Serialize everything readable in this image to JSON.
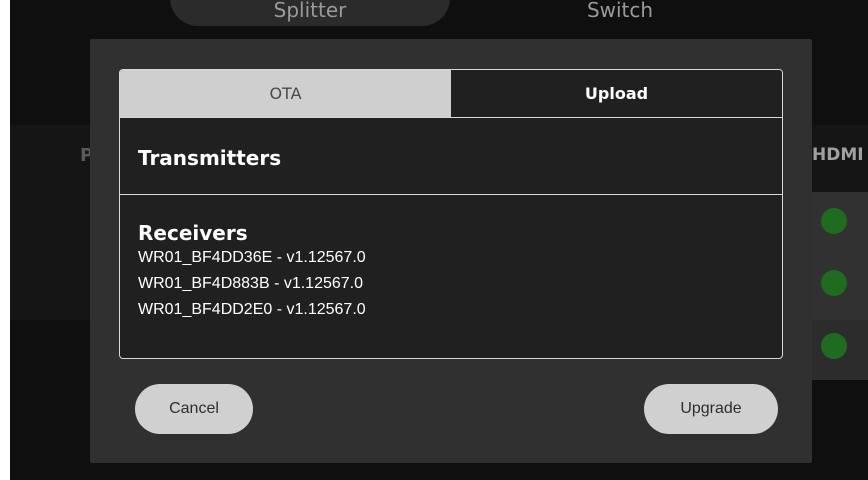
{
  "background": {
    "top_buttons": [
      "Splitter",
      "Switch"
    ],
    "table_header_left": "P",
    "table_header_right": "HDMI",
    "status_color": "#1f6b1f"
  },
  "dialog": {
    "tabs": [
      {
        "label": "OTA",
        "active": false
      },
      {
        "label": "Upload",
        "active": true
      }
    ],
    "transmitters": {
      "title": "Transmitters",
      "items": []
    },
    "receivers": {
      "title": "Receivers",
      "items": [
        "WR01_BF4DD36E - v1.12567.0",
        "WR01_BF4D883B - v1.12567.0",
        "WR01_BF4DD2E0 - v1.12567.0"
      ]
    },
    "buttons": {
      "cancel": "Cancel",
      "upgrade": "Upgrade"
    }
  }
}
